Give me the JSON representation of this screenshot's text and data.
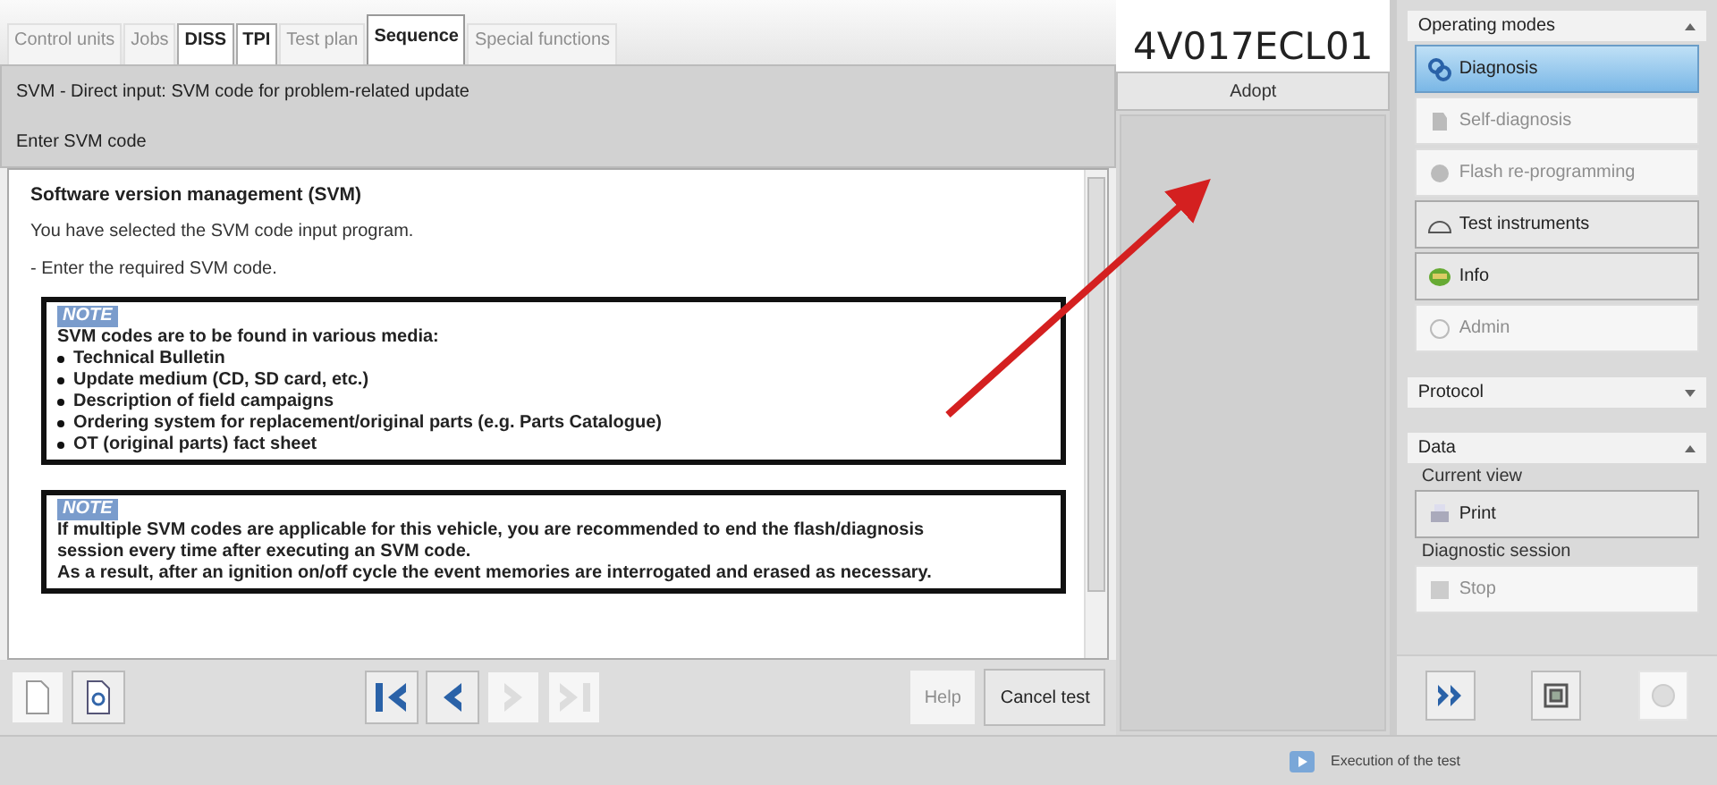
{
  "tabs": [
    {
      "label": "Control units",
      "selected": false,
      "disabled": true
    },
    {
      "label": "Jobs",
      "selected": false,
      "disabled": true
    },
    {
      "label": "DISS",
      "selected": false,
      "disabled": false
    },
    {
      "label": "TPI",
      "selected": false,
      "disabled": false
    },
    {
      "label": "Test plan",
      "selected": false,
      "disabled": true
    },
    {
      "label": "Sequence",
      "selected": true,
      "disabled": false
    },
    {
      "label": "Special functions",
      "selected": false,
      "disabled": true
    }
  ],
  "header": {
    "title": "SVM - Direct input: SVM code for problem-related update",
    "subtitle": "Enter SVM code"
  },
  "content": {
    "heading": "Software version management (SVM)",
    "paragraphs": [
      "You have selected the SVM code input program.",
      "- Enter the required SVM code."
    ],
    "notes": [
      {
        "label": "NOTE",
        "lines": [
          "SVM codes are to be found in various media:"
        ],
        "items": [
          "Technical Bulletin",
          "Update medium (CD, SD card, etc.)",
          "Description of field campaigns",
          "Ordering system for replacement/original parts (e.g. Parts Catalogue)",
          "OT (original parts) fact sheet"
        ]
      },
      {
        "label": "NOTE",
        "lines": [
          "If multiple SVM codes are applicable for this vehicle, you are recommended to end the flash/diagnosis",
          "session every time after executing an SVM code.",
          "As a result, after an ignition on/off cycle the event memories are interrogated and erased as necessary."
        ]
      }
    ]
  },
  "svm_code": "4V017ECL01",
  "adopt_button": "Adopt",
  "toolbar": {
    "left_buttons": [
      {
        "kind": "document",
        "disabled": true
      },
      {
        "kind": "preview",
        "disabled": false
      }
    ],
    "nav_buttons": [
      {
        "kind": "first",
        "disabled": false
      },
      {
        "kind": "prev",
        "disabled": false
      },
      {
        "kind": "next",
        "disabled": true
      },
      {
        "kind": "last",
        "disabled": true
      }
    ],
    "buttons": [
      {
        "label": "Help",
        "disabled": true
      },
      {
        "label": "Cancel test",
        "disabled": false
      }
    ]
  },
  "sidebar": {
    "operating_modes": {
      "title": "Operating modes",
      "expanded": true,
      "items": [
        {
          "label": "Diagnosis",
          "kind": "diagnosis",
          "selected": true,
          "disabled": false
        },
        {
          "label": "Self-diagnosis",
          "kind": "selfdiag",
          "selected": false,
          "disabled": true
        },
        {
          "label": "Flash re-programming",
          "kind": "flash",
          "selected": false,
          "disabled": true
        },
        {
          "label": "Test instruments",
          "kind": "instruments",
          "selected": false,
          "disabled": false
        },
        {
          "label": "Info",
          "kind": "info",
          "selected": false,
          "disabled": false
        },
        {
          "label": "Admin",
          "kind": "admin",
          "selected": false,
          "disabled": true
        }
      ]
    },
    "protocol": {
      "title": "Protocol",
      "expanded": false
    },
    "data": {
      "title": "Data",
      "expanded": true,
      "groups": [
        {
          "title": "Current view",
          "button": {
            "label": "Print",
            "kind": "print",
            "disabled": false
          }
        },
        {
          "title": "Diagnostic session",
          "button": {
            "label": "Stop",
            "kind": "stop",
            "disabled": true
          }
        }
      ]
    },
    "bottom_buttons": [
      {
        "kind": "forward",
        "disabled": false
      },
      {
        "kind": "fullscreen",
        "disabled": false
      },
      {
        "kind": "close",
        "disabled": true
      }
    ]
  },
  "status_bar": {
    "text": "Execution of the test"
  }
}
